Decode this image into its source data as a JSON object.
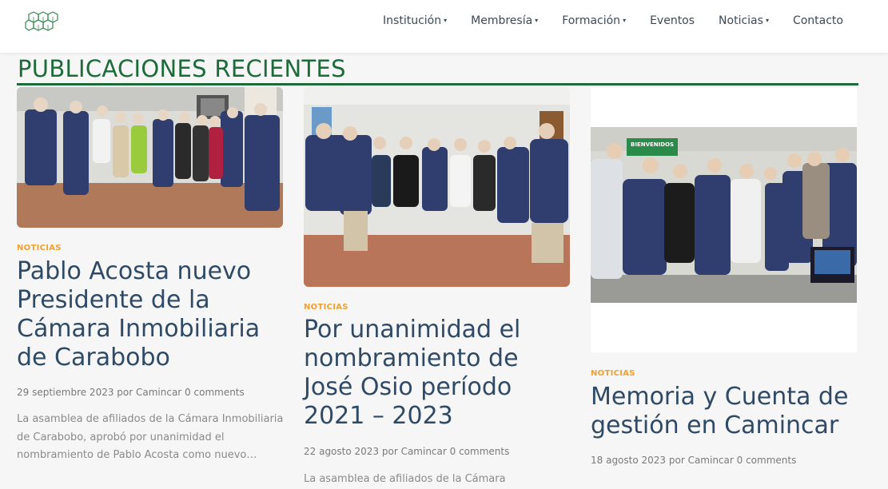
{
  "nav": {
    "items": [
      {
        "label": "Institución",
        "caret": "▾"
      },
      {
        "label": "Membresía",
        "caret": "▾"
      },
      {
        "label": "Formación",
        "caret": "▾"
      },
      {
        "label": "Eventos",
        "caret": ""
      },
      {
        "label": "Noticias",
        "caret": "▾"
      },
      {
        "label": "Contacto",
        "caret": ""
      }
    ]
  },
  "logo_icon": "hexagon-cubes-logo",
  "section": {
    "title": "PUBLICACIONES RECIENTES"
  },
  "colors": {
    "brand_green": "#1e6b3a",
    "category_orange": "#f0a030",
    "title_blue": "#2f4a66"
  },
  "posts": [
    {
      "category": "NOTICIAS",
      "title": "Pablo Acosta nuevo Presidente de la Cámara Inmobiliaria de Carabobo",
      "meta": "29 septiembre 2023 por Camincar 0 comments",
      "excerpt": "La asamblea de afiliados de la Cámara Inmobiliaria de Carabobo, aprobó por unanimidad el nombramiento de Pablo Acosta como nuevo…"
    },
    {
      "category": "NOTICIAS",
      "title": "Por unanimidad el nombramiento de José Osio período 2021 – 2023",
      "meta": "22 agosto 2023 por Camincar 0 comments",
      "excerpt": "La asamblea de afiliados de la Cámara"
    },
    {
      "category": "NOTICIAS",
      "title": "Memoria y Cuenta de gestión en Camincar",
      "meta": "18 agosto 2023 por Camincar 0 comments",
      "image_banner": "BIENVENIDOS"
    }
  ]
}
